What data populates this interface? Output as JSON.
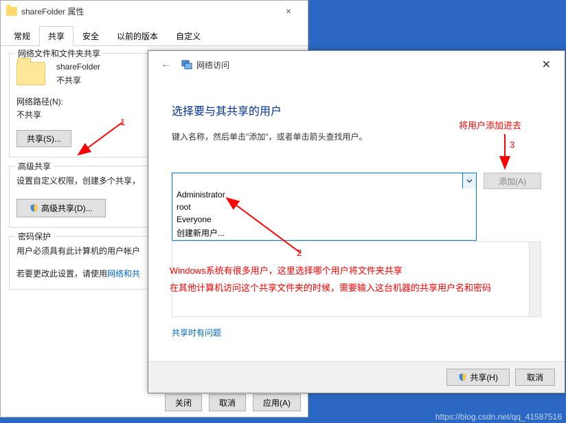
{
  "props": {
    "title": "shareFolder 属性",
    "tabs": [
      "常规",
      "共享",
      "安全",
      "以前的版本",
      "自定义"
    ],
    "active_tab": 1,
    "group_network": {
      "legend": "网络文件和文件夹共享",
      "folder_name": "shareFolder",
      "share_state": "不共享",
      "path_label": "网络路径(N):",
      "path_value": "不共享",
      "share_btn": "共享(S)..."
    },
    "group_adv": {
      "legend": "高级共享",
      "desc": "设置自定义权限，创建多个共享，",
      "btn": "高级共享(D)..."
    },
    "group_pwd": {
      "legend": "密码保护",
      "line1": "用户必须具有此计算机的用户帐户",
      "line2_a": "若要更改此设置，请使用",
      "line2_link": "网络和共"
    },
    "btn_close": "关闭",
    "btn_cancel": "取消",
    "btn_apply": "应用(A)"
  },
  "wizard": {
    "title": "网络访问",
    "heading": "选择要与其共享的用户",
    "sub": "键入名称，然后单击\"添加\"，或者单击箭头查找用户。",
    "add_btn": "添加(A)",
    "options": [
      "Administrator",
      "root",
      "Everyone",
      "创建新用户..."
    ],
    "trouble": "共享时有问题",
    "share_btn": "共享(H)",
    "cancel_btn": "取消"
  },
  "anno": {
    "n1": "1",
    "n2": "2",
    "n3": "3",
    "note_top": "将用户添加进去",
    "note_line1": "Windows系统有很多用户，这里选择哪个用户将文件夹共享",
    "note_line2": "在其他计算机访问这个共享文件夹的时候，需要输入这台机器的共享用户名和密码"
  },
  "watermark": "https://blog.csdn.net/qq_41587516"
}
